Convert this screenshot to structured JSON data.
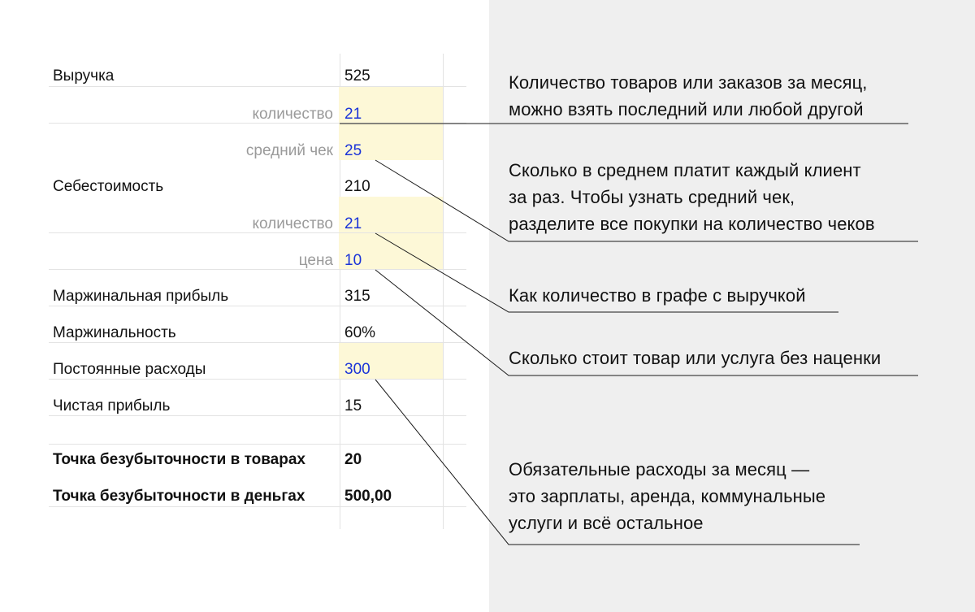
{
  "rows": [
    {
      "label": "Выручка",
      "value": "525",
      "style": "main"
    },
    {
      "label": "количество",
      "value": "21",
      "style": "sub"
    },
    {
      "label": "средний чек",
      "value": "25",
      "style": "sub"
    },
    {
      "label": "Себестоимость",
      "value": "210",
      "style": "main"
    },
    {
      "label": "количество",
      "value": "21",
      "style": "sub"
    },
    {
      "label": "цена",
      "value": "10",
      "style": "sub"
    },
    {
      "label": "Маржинальная прибыль",
      "value": "315",
      "style": "main"
    },
    {
      "label": "Маржинальность",
      "value": "60%",
      "style": "main"
    },
    {
      "label": "Постоянные расходы",
      "value": "300",
      "style": "input"
    },
    {
      "label": "Чистая прибыль",
      "value": "15",
      "style": "main"
    },
    {
      "label": "Точка безубыточности в товарах",
      "value": "20",
      "style": "bold"
    },
    {
      "label": "Точка безубыточности в деньгах",
      "value": "500,00",
      "style": "bold"
    }
  ],
  "notes": [
    "Количество товаров или заказов за месяц,\nможно взять последний или любой другой",
    "Сколько в среднем платит каждый клиент\nза раз. Чтобы узнать средний чек,\nразделите все покупки на количество чеков",
    "Как количество в графе с выручкой",
    "Сколько стоит товар или услуга без наценки",
    "Обязательные расходы за месяц —\nэто зарплаты, аренда, коммунальные\nуслуги и всё остальное"
  ],
  "colors": {
    "input_value": "#1a33d8",
    "highlight": "#fdf8d7",
    "sub_label": "#9a9a9a",
    "panel": "#efefef"
  }
}
